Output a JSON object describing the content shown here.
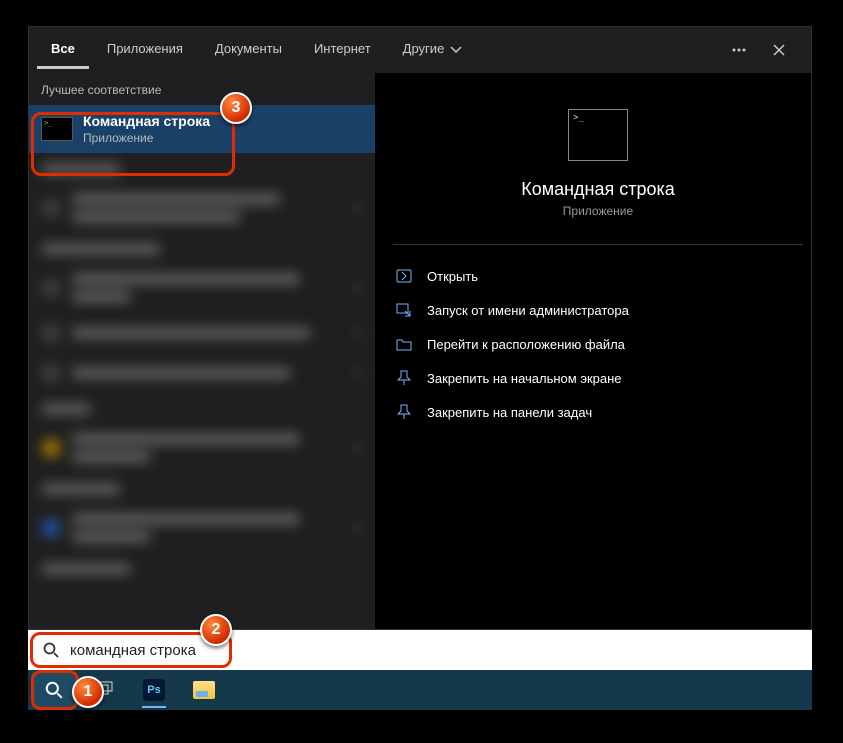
{
  "tabs": {
    "all": "Все",
    "apps": "Приложения",
    "docs": "Документы",
    "web": "Интернет",
    "more": "Другие"
  },
  "left": {
    "best_match_header": "Лучшее соответствие",
    "top_result": {
      "title": "Командная строка",
      "subtitle": "Приложение"
    }
  },
  "preview": {
    "title": "Командная строка",
    "subtitle": "Приложение"
  },
  "actions": {
    "open": "Открыть",
    "run_admin": "Запуск от имени администратора",
    "open_location": "Перейти к расположению файла",
    "pin_start": "Закрепить на начальном экране",
    "pin_taskbar": "Закрепить на панели задач"
  },
  "search": {
    "value": "командная строка"
  },
  "badges": {
    "b1": "1",
    "b2": "2",
    "b3": "3"
  }
}
